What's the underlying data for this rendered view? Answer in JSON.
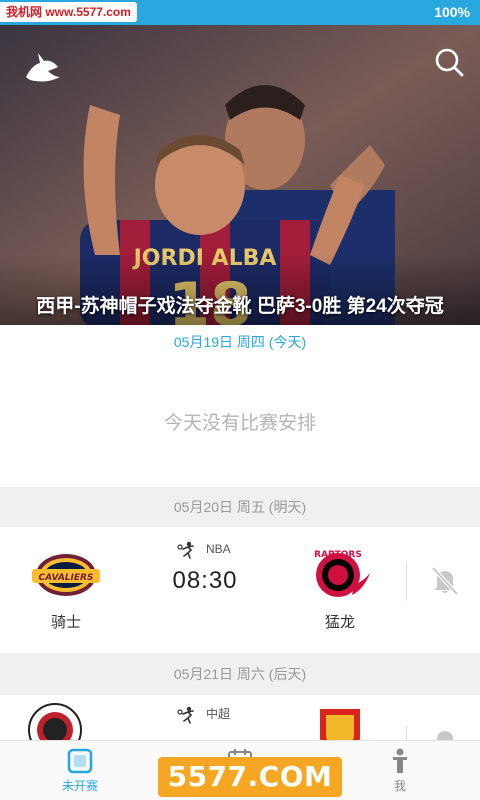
{
  "status_bar": {
    "site_label": "我机网 www.5577.com",
    "battery": "100%"
  },
  "hero": {
    "caption": "西甲-苏神帽子戏法夺金靴 巴萨3-0胜 第24次夺冠",
    "jersey_name": "JORDI ALBA",
    "jersey_number": "18"
  },
  "schedule": {
    "today": {
      "date_label": "05月19日 周四 (今天)",
      "empty_message": "今天没有比赛安排"
    },
    "tomorrow": {
      "date_label": "05月20日 周五 (明天)",
      "match": {
        "league": "NBA",
        "time": "08:30",
        "home_team": "骑士",
        "away_team": "猛龙",
        "home_logo_text": "CAVALIERS",
        "away_logo_text": "RAPTORS"
      }
    },
    "day_after": {
      "date_label": "05月21日 周六 (后天)",
      "match": {
        "league": "中超"
      }
    }
  },
  "bottom_nav": {
    "items": [
      {
        "label": "未开赛",
        "active": true
      },
      {
        "label": "",
        "active": false
      },
      {
        "label": "我",
        "active": false
      }
    ]
  },
  "watermark": "5577.COM",
  "colors": {
    "accent": "#29a8df",
    "watermark": "#f5a623"
  }
}
